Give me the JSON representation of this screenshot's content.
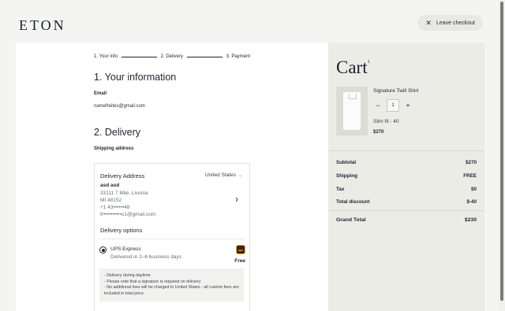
{
  "header": {
    "logo": "ETON",
    "leave_checkout": "Leave checkout"
  },
  "steps": [
    "1. Your info",
    "2. Delivery",
    "3. Payment"
  ],
  "info": {
    "heading": "1. Your information",
    "email_label": "Email",
    "email_value": "namefreites@gmail.com"
  },
  "delivery": {
    "heading": "2. Delivery",
    "shipping_label": "Shipping address",
    "address_title": "Delivery Address",
    "country": "United States",
    "name": "asd asd",
    "lines": [
      "33111 7 Mile, Livonia",
      "MI 48152",
      "+1 43••••••48",
      "fr••••••••••o1@gmail.com"
    ],
    "options_title": "Delivery options",
    "option": {
      "name": "UPS Express",
      "subtitle": "Delivered in 2–6 business days",
      "price": "Free",
      "carrier_icon": "ups-logo-icon"
    },
    "notes": [
      "- Delivery during daytime",
      "- Please note that a signature is required on delivery",
      "- No additional fees will be charged to United States - all custom fees are included in total price."
    ]
  },
  "cart": {
    "title": "Cart",
    "count": "1",
    "product": {
      "name": "Signature Twill Shirt",
      "quantity": "1",
      "minus": "−",
      "plus": "+",
      "variant": "Slim fit - 40",
      "price": "$270"
    },
    "summary": [
      {
        "label": "Subtotal",
        "value": "$270"
      },
      {
        "label": "Shipping",
        "value": "FREE"
      },
      {
        "label": "Tax",
        "value": "$0"
      },
      {
        "label": "Total discount",
        "value": "$-40"
      }
    ],
    "grand_total": {
      "label": "Grand Total",
      "value": "$230"
    }
  }
}
